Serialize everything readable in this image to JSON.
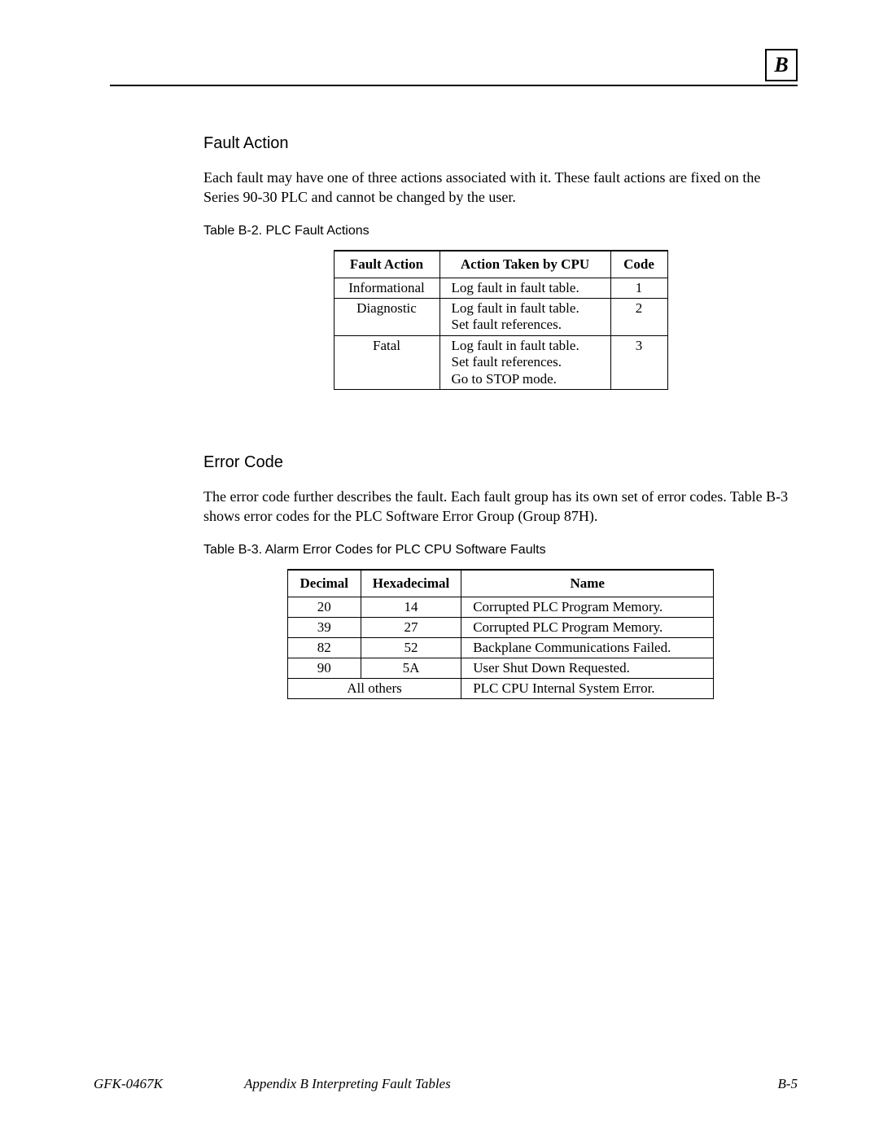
{
  "appendix_letter": "B",
  "section1": {
    "heading": "Fault Action",
    "paragraph": "Each fault may have one of three actions associated with it.  These fault actions are fixed on the Series 90-30 PLC and cannot be changed by the user.",
    "table_caption": "Table B-2.  PLC Fault Actions",
    "table": {
      "headers": [
        "Fault Action",
        "Action Taken by CPU",
        "Code"
      ],
      "rows": [
        {
          "fault_action": "Informational",
          "cpu_action": [
            "Log fault in fault table."
          ],
          "code": "1"
        },
        {
          "fault_action": "Diagnostic",
          "cpu_action": [
            "Log fault in fault table.",
            "Set fault references."
          ],
          "code": "2"
        },
        {
          "fault_action": "Fatal",
          "cpu_action": [
            "Log fault in fault table.",
            "Set fault references.",
            "Go to STOP mode."
          ],
          "code": "3"
        }
      ]
    }
  },
  "section2": {
    "heading": "Error Code",
    "paragraph": "The error code further describes the fault.  Each fault group has its own set of error codes. Table B-3 shows error codes for the PLC Software Error Group (Group 87H).",
    "table_caption": "Table B-3.  Alarm Error Codes for PLC CPU Software Faults",
    "table": {
      "headers": [
        "Decimal",
        "Hexadecimal",
        "Name"
      ],
      "rows": [
        {
          "decimal": "20",
          "hex": "14",
          "name": "Corrupted PLC Program Memory."
        },
        {
          "decimal": "39",
          "hex": "27",
          "name": "Corrupted PLC Program Memory."
        },
        {
          "decimal": "82",
          "hex": "52",
          "name": "Backplane Communications Failed."
        },
        {
          "decimal": "90",
          "hex": "5A",
          "name": "User Shut Down Requested."
        }
      ],
      "last_row": {
        "span_label": "All others",
        "name": "PLC CPU Internal System Error."
      }
    }
  },
  "footer": {
    "doc_id": "GFK-0467K",
    "chapter": "Appendix B  Interpreting Fault Tables",
    "page": "B-5"
  }
}
